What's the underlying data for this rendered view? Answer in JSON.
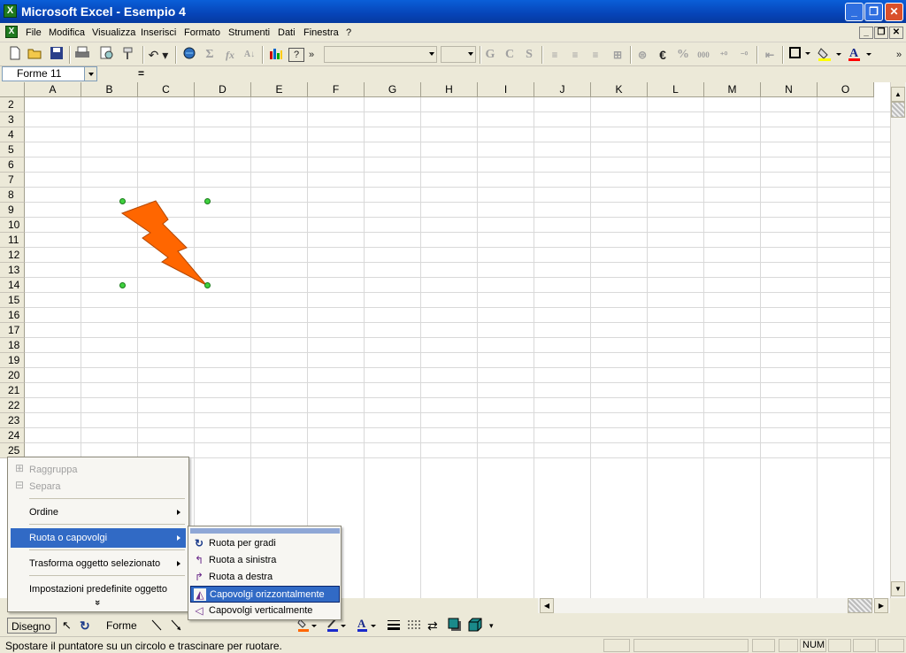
{
  "window": {
    "title": "Microsoft Excel - Esempio 4",
    "minimize": "_",
    "restore": "❐",
    "close": "✕"
  },
  "menubar": {
    "items": [
      "File",
      "Modifica",
      "Visualizza",
      "Inserisci",
      "Formato",
      "Strumenti",
      "Dati",
      "Finestra",
      "?"
    ],
    "doc_minimize": "_",
    "doc_restore": "❐",
    "doc_close": "✕"
  },
  "toolbar": {
    "icons": [
      "new-icon",
      "open-icon",
      "save-icon",
      "print-icon",
      "print-preview-icon",
      "format-painter-icon",
      "undo-icon",
      "hyperlink-icon",
      "autosum-icon",
      "function-icon",
      "sort-icon",
      "chart-icon",
      "help-icon"
    ],
    "sigma": "Σ",
    "fx": "fx",
    "bold": "G",
    "italic": "C",
    "underline": "S",
    "euro": "€",
    "percent": "%",
    "thousands": "000"
  },
  "formula_bar": {
    "name_box": "Forme 11",
    "equals": "="
  },
  "sheet": {
    "columns": [
      "A",
      "B",
      "C",
      "D",
      "E",
      "F",
      "G",
      "H",
      "I",
      "J",
      "K",
      "L",
      "M",
      "N",
      "O"
    ],
    "rows": [
      "2",
      "3",
      "4",
      "5",
      "6",
      "7",
      "8",
      "9",
      "10",
      "11",
      "12",
      "13",
      "14",
      "15",
      "16",
      "17",
      "18",
      "19",
      "20",
      "21",
      "22",
      "23",
      "24",
      "25"
    ]
  },
  "shape": {
    "type": "lightning-bolt",
    "fill": "#ff6600",
    "selected": true
  },
  "draw_menu": {
    "items": [
      {
        "label": "Raggruppa",
        "enabled": false
      },
      {
        "label": "Separa",
        "enabled": false
      },
      {
        "label": "Ordine",
        "enabled": true,
        "submenu": true
      },
      {
        "label": "Ruota o capovolgi",
        "enabled": true,
        "submenu": true,
        "highlighted": true
      },
      {
        "label": "Trasforma oggetto selezionato",
        "enabled": true,
        "submenu": true
      },
      {
        "label": "Impostazioni predefinite oggetto",
        "enabled": true
      }
    ],
    "more": "»"
  },
  "rotate_submenu": {
    "items": [
      {
        "label": "Ruota per gradi",
        "icon": "free-rotate-icon"
      },
      {
        "label": "Ruota a sinistra",
        "icon": "rotate-left-icon"
      },
      {
        "label": "Ruota a destra",
        "icon": "rotate-right-icon"
      },
      {
        "label": "Capovolgi orizzontalmente",
        "icon": "flip-horizontal-icon",
        "highlighted": true
      },
      {
        "label": "Capovolgi verticalmente",
        "icon": "flip-vertical-icon"
      }
    ]
  },
  "drawing_toolbar": {
    "draw_button": "Disegno",
    "shapes_button": "Forme"
  },
  "status": {
    "text": "Spostare il puntatore su un circolo e trascinare per ruotare.",
    "num": "NUM"
  },
  "colors": {
    "title_bar": "#0644b8",
    "highlight": "#316ac5",
    "shape": "#ff6600",
    "handles": "#3fd13f"
  }
}
